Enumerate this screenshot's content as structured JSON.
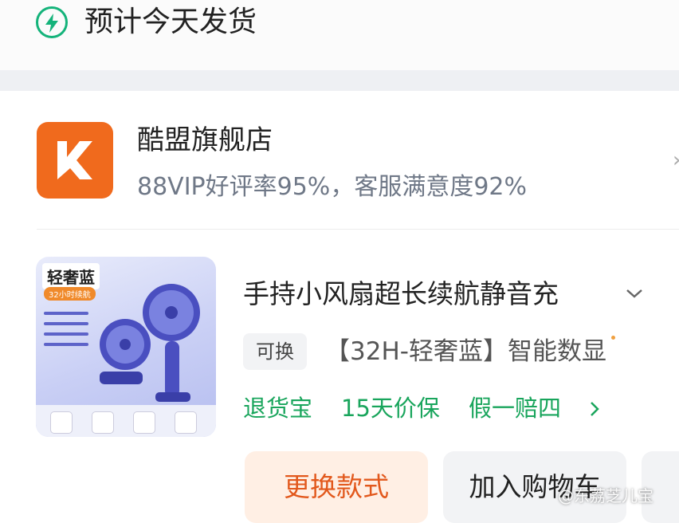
{
  "header": {
    "shipping_title": "预计今天发货",
    "icon": "lightning-bolt-icon",
    "accent_color": "#14b37a"
  },
  "shop": {
    "logo_icon": "kuromeng-k-logo",
    "logo_color": "#f06a1d",
    "name": "酷盟旗舰店",
    "stats": "88VIP好评率95%，客服满意度92%"
  },
  "product": {
    "thumbnail_label": "轻奢蓝",
    "thumbnail_sub": "32小时续航",
    "title": "手持小风扇超长续航静音充",
    "exchange_tag": "可换",
    "variant": "【32H-轻奢蓝】智能数显",
    "expand_icon": "chevron-down-icon"
  },
  "guarantees": {
    "items": [
      "退货宝",
      "15天价保",
      "假一赔四"
    ],
    "color": "#19a55c",
    "more_icon": "chevron-right-icon"
  },
  "actions": {
    "change_style_label": "更换款式",
    "add_to_cart_label": "加入购物车"
  },
  "watermark": "@东荔芝儿宝"
}
